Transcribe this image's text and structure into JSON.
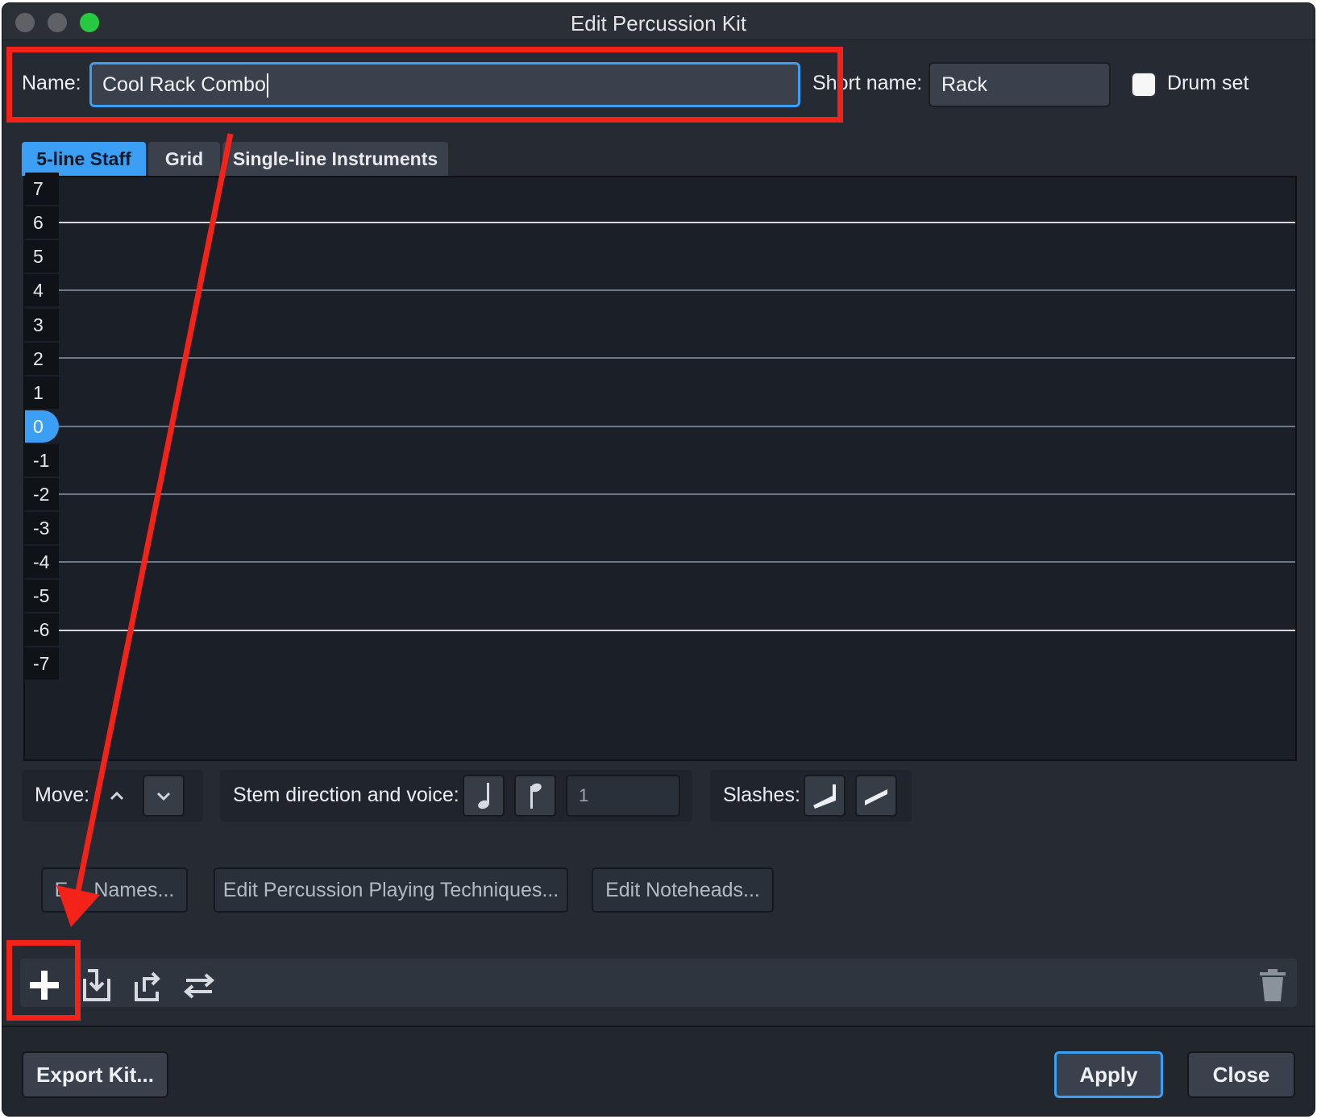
{
  "window": {
    "title": "Edit Percussion Kit"
  },
  "header": {
    "name_label": "Name:",
    "name_value": "Cool Rack Combo",
    "short_name_label": "Short name:",
    "short_name_value": "Rack",
    "drum_set_label": "Drum set",
    "drum_set_checked": false
  },
  "tabs": [
    {
      "label": "5-line Staff",
      "active": true
    },
    {
      "label": "Grid",
      "active": false
    },
    {
      "label": "Single-line Instruments",
      "active": false
    }
  ],
  "staff": {
    "positions": [
      "7",
      "6",
      "5",
      "4",
      "3",
      "2",
      "1",
      "0",
      "-1",
      "-2",
      "-3",
      "-4",
      "-5",
      "-6",
      "-7"
    ],
    "selected_position": "0"
  },
  "controls": {
    "move_label": "Move:",
    "move_up_icon": "chevron-up-icon",
    "move_down_icon": "chevron-down-icon",
    "stem_label": "Stem direction and voice:",
    "stem_up_icon": "stem-down-note-icon",
    "stem_down_icon": "stem-up-note-icon",
    "voice_value": "1",
    "slashes_label": "Slashes:",
    "slash_icons": [
      "slash-steep-icon",
      "slash-shallow-icon"
    ]
  },
  "edit_buttons": {
    "names": "Edit Names...",
    "names_visible": "Names...",
    "names_visible_prefix": "E",
    "techniques": "Edit Percussion Playing Techniques...",
    "noteheads": "Edit Noteheads..."
  },
  "toolbar": {
    "icons": [
      "add-icon",
      "import-icon",
      "export-icon",
      "swap-icon"
    ],
    "delete_icon": "trash-icon"
  },
  "footer": {
    "export_label": "Export Kit...",
    "apply_label": "Apply",
    "close_label": "Close"
  },
  "colors": {
    "accent": "#3a9ff5",
    "annotation": "#f4231a",
    "background": "#262b33",
    "staff_background": "#1b2028",
    "max_button": "#28c840"
  }
}
